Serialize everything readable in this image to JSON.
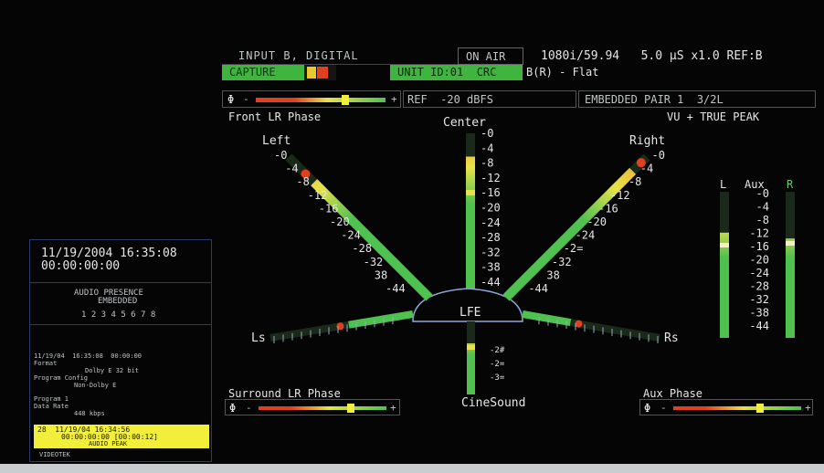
{
  "header": {
    "input_label": "INPUT B, DIGITAL",
    "on_air": "ON AIR",
    "format": "1080i/59.94   5.0 µS x1.0 REF:B",
    "capture": "CAPTURE",
    "unit_id": "UNIT ID:01  CRC",
    "mode": "B(R) - Flat",
    "phase_symbol": "Φ",
    "minus": "-",
    "plus": "+",
    "ref": "REF  -20 dBFS",
    "embedded_pair": "EMBEDDED PAIR 1  3/2L",
    "front_phase_label": "Front LR Phase",
    "vu_mode": "VU + TRUE PEAK"
  },
  "channels": {
    "left": "Left",
    "center": "Center",
    "right": "Right",
    "ls": "Ls",
    "rs": "Rs",
    "lfe": "LFE",
    "cinesound": "CineSound"
  },
  "scale": {
    "left": [
      "-0",
      "-4",
      "-8",
      "-12",
      "-16",
      "-20",
      "-24",
      "-28",
      "-32",
      "38",
      "-44"
    ],
    "right": [
      "-0",
      "-4",
      "-8",
      "-12",
      "-16",
      "-20",
      "-24",
      "-2=",
      "-32",
      "38",
      "-44"
    ],
    "center": [
      "-0",
      "-4",
      "-8",
      "-12",
      "-16",
      "-20",
      "-24",
      "-28",
      "-32",
      "-38",
      "-44"
    ],
    "lfe": [
      "-2#",
      "-2=",
      "-3="
    ]
  },
  "levels": {
    "left": 0.82,
    "right": 0.9,
    "center": 0.85,
    "ls": 0.45,
    "rs": 0.35,
    "lfe": 0.7,
    "aux_l": 0.72,
    "aux_r": 0.68
  },
  "aux_meter": {
    "l_label": "L",
    "aux_label": "Aux",
    "r_label": "R",
    "scale": [
      "-0",
      "-4",
      "-8",
      "-12",
      "-16",
      "-20",
      "-24",
      "-28",
      "-32",
      "-38",
      "-44"
    ]
  },
  "surround_phase_label": "Surround LR Phase",
  "aux_phase_label": "Aux Phase",
  "phase": {
    "front": 0.7,
    "surround": 0.72,
    "aux": 0.68
  },
  "left_panel": {
    "datetime": "11/19/2004 16:35:08",
    "timecode": "00:00:00:00",
    "presence_title": "AUDIO PRESENCE",
    "presence_sub": "EMBEDDED",
    "presence_channels": "1 2 3 4 5 6 7 8",
    "log_line1": "11/19/04  16:35:08  00:00:00",
    "log_line2": "Format",
    "log_line3": "Dolby E 32 bit",
    "log_line4": "Program Config",
    "log_line5": "Non-Dolby E",
    "log_line6": "Program 1",
    "log_line7": "Data Rate",
    "log_line8": "448 kbps",
    "alarm_line1": "28  11/19/04 16:34:56",
    "alarm_line2": "00:00:00:00 [00:00:12]",
    "alarm_line3": "AUDIO PEAK",
    "footer": "VIDEOTEK"
  },
  "colors": {
    "bar_green": "#4fc14f",
    "bar_yellow": "#e8e24a",
    "peak_red": "#e04020",
    "capture_bg": "#3fb43f",
    "alarm_bg": "#f2ef3a"
  }
}
